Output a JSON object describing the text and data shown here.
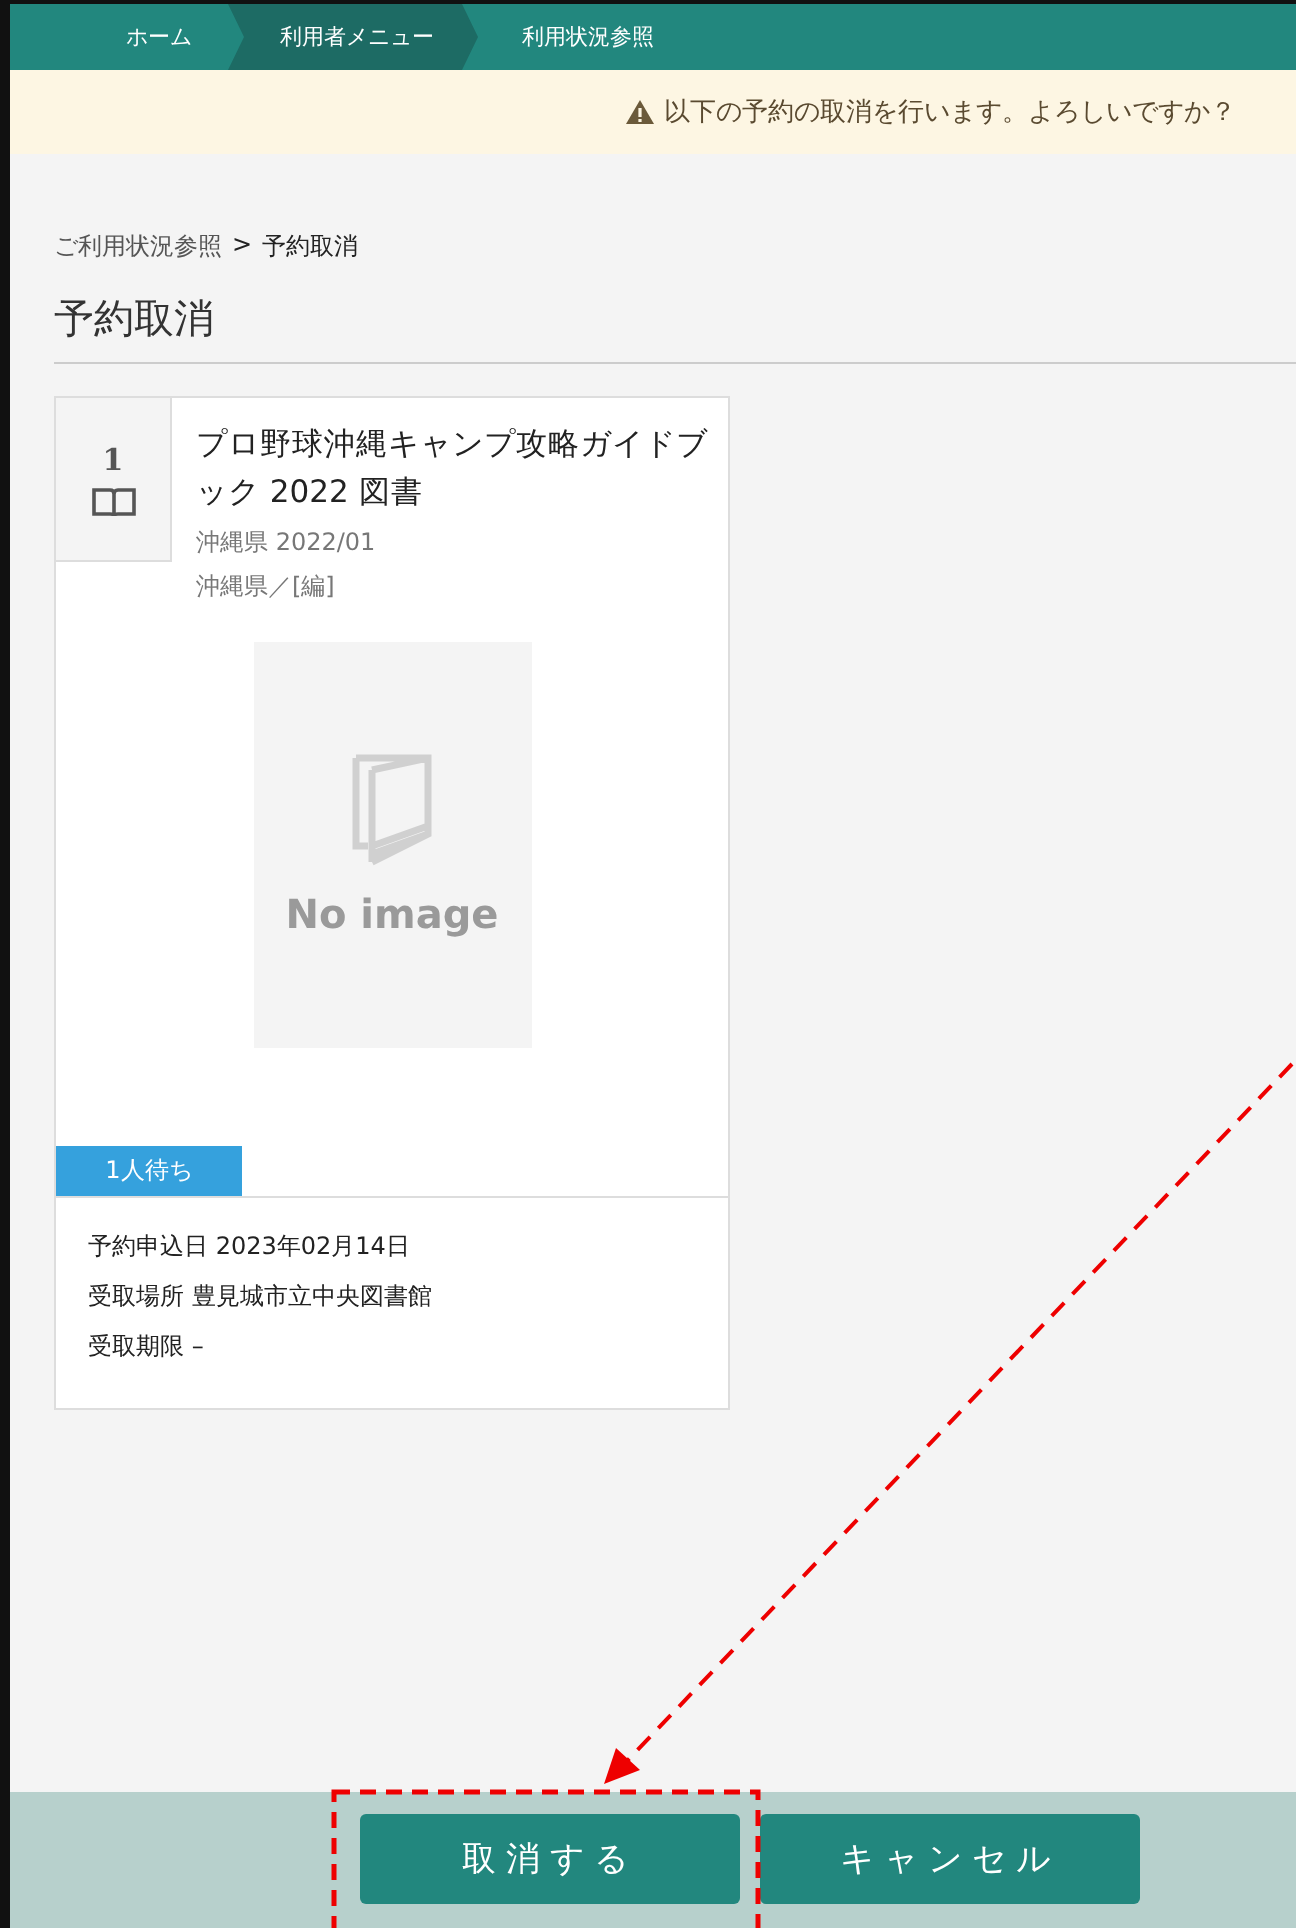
{
  "nav": [
    {
      "label": "ホーム",
      "selected": false
    },
    {
      "label": "利用者メニュー",
      "selected": true
    },
    {
      "label": "利用状況参照",
      "selected": false
    }
  ],
  "notice": {
    "text": "以下の予約の取消を行います。よろしいですか？"
  },
  "breadcrumb": [
    {
      "label": "ご利用状況参照",
      "kind": "link"
    },
    {
      "label": ">",
      "kind": "separator"
    },
    {
      "label": "予約取消",
      "kind": "current"
    }
  ],
  "page_title": "予約取消",
  "items": [
    {
      "number": "1",
      "title": "プロ野球沖縄キャンプ攻略ガイドブック 2022 図書",
      "publisher": "沖縄県 2022/01",
      "author": "沖縄県／[編]",
      "cover_placeholder": "No image",
      "waiting_badge": "1人待ち",
      "details": [
        "予約申込日 2023年02月14日",
        "受取場所 豊見城市立中央図書館",
        "受取期限 –"
      ]
    }
  ],
  "buttons": [
    "取消する",
    "キャンセル"
  ]
}
